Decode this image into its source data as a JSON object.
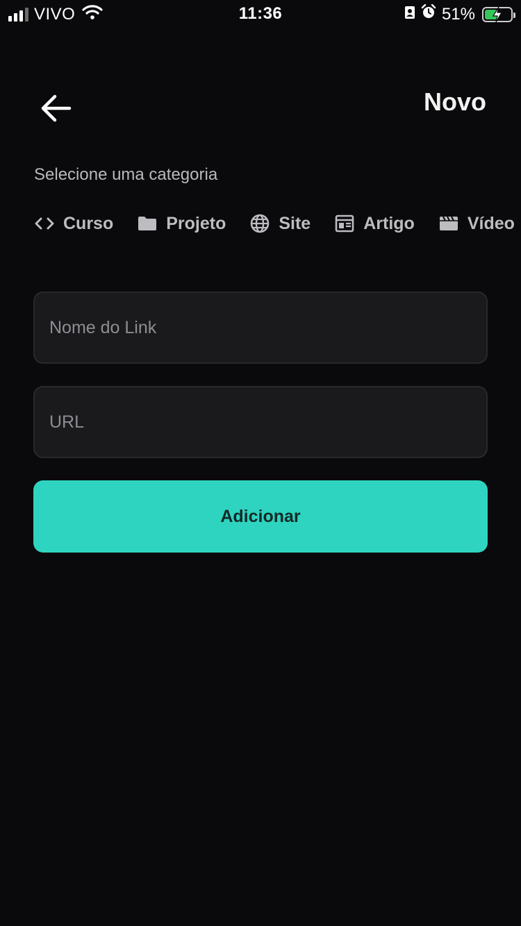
{
  "status_bar": {
    "carrier": "VIVO",
    "time": "11:36",
    "battery_percent": "51%",
    "battery_level": 0.51,
    "icons": [
      "signal-icon",
      "wifi-icon",
      "portrait-lock-icon",
      "alarm-icon",
      "battery-icon"
    ]
  },
  "header": {
    "back_icon": "arrow-left-icon",
    "title": "Novo"
  },
  "category_section": {
    "label": "Selecione uma categoria",
    "items": [
      {
        "label": "Curso",
        "icon": "code-icon"
      },
      {
        "label": "Projeto",
        "icon": "folder-icon"
      },
      {
        "label": "Site",
        "icon": "globe-icon"
      },
      {
        "label": "Artigo",
        "icon": "article-icon"
      },
      {
        "label": "Vídeo",
        "icon": "clapperboard-icon"
      }
    ]
  },
  "form": {
    "name_placeholder": "Nome do Link",
    "name_value": "",
    "url_placeholder": "URL",
    "url_value": "",
    "submit_label": "Adicionar"
  },
  "colors": {
    "background": "#0a0a0c",
    "input_background": "#1a1a1d",
    "accent": "#2ed4c0",
    "muted_text": "#b9b9be"
  }
}
